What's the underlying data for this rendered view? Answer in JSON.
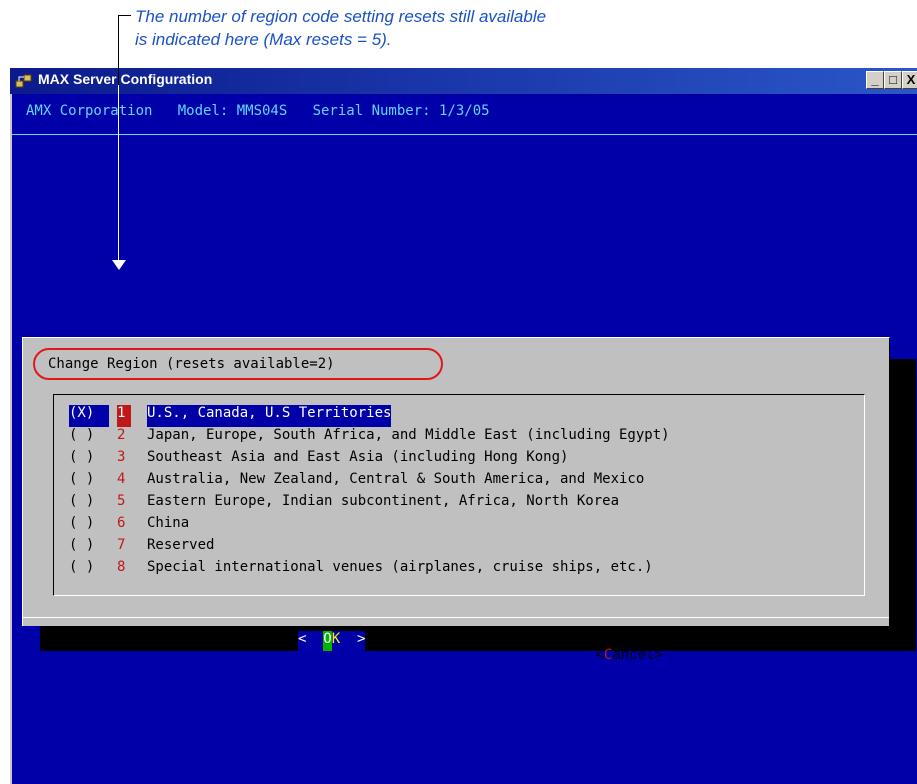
{
  "annotation": {
    "line1": "The number of region code setting resets still available",
    "line2": "is indicated here (Max resets = 5)."
  },
  "window": {
    "title": "MAX Server Configuration",
    "controls": [
      "_",
      "□",
      "X"
    ]
  },
  "header": {
    "text": "AMX Corporation   Model: MMS04S   Serial Number: 1/3/05"
  },
  "dialog": {
    "title": "Change Region (resets available=2)",
    "items": [
      {
        "radio": "(X)",
        "num": "1",
        "label": "U.S., Canada, U.S Territories"
      },
      {
        "radio": "( )",
        "num": "2",
        "label": "Japan, Europe, South Africa, and Middle East (including Egypt)"
      },
      {
        "radio": "( )",
        "num": "3",
        "label": "Southeast Asia and East Asia (including Hong Kong)"
      },
      {
        "radio": "( )",
        "num": "4",
        "label": "Australia, New Zealand, Central & South America, and Mexico"
      },
      {
        "radio": "( )",
        "num": "5",
        "label": "Eastern Europe, Indian subcontinent, Africa, North Korea"
      },
      {
        "radio": "( )",
        "num": "6",
        "label": "China"
      },
      {
        "radio": "( )",
        "num": "7",
        "label": "Reserved"
      },
      {
        "radio": "( )",
        "num": "8",
        "label": "Special international venues (airplanes, cruise ships, etc.)"
      }
    ],
    "ok": {
      "left": "<  ",
      "hot": "O",
      "rest": "K",
      "right": "  >"
    },
    "cancel": {
      "open": "<",
      "hot": "C",
      "rest": "ancel",
      "close": ">"
    }
  },
  "colors": {
    "terminal_bg": "#0000a8",
    "header_text": "#5fd7ff",
    "hotkey_red": "#c01818",
    "annotation_blue": "#1a50c8"
  }
}
